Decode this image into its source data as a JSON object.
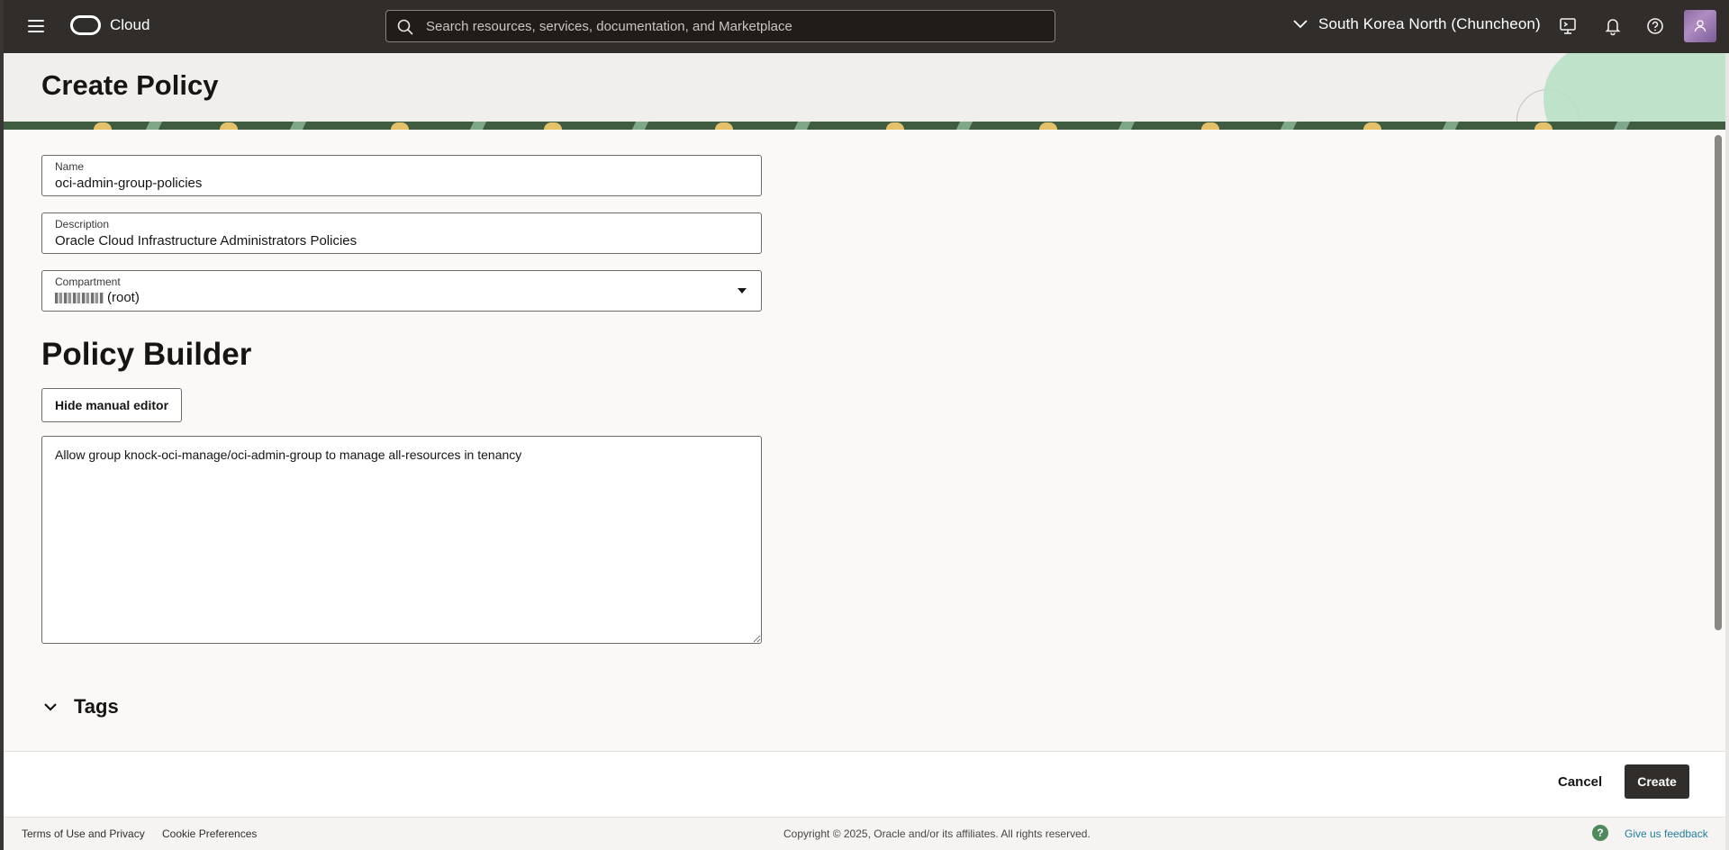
{
  "header": {
    "brand": "Cloud",
    "search_placeholder": "Search resources, services, documentation, and Marketplace",
    "region": "South Korea North (Chuncheon)",
    "icons": [
      "menu-icon",
      "oracle-logo",
      "search-icon",
      "chevron-down-icon",
      "cloud-shell-icon",
      "bell-icon",
      "help-icon",
      "user-icon"
    ]
  },
  "page": {
    "title": "Create Policy"
  },
  "form": {
    "name_label": "Name",
    "name_value": "oci-admin-group-policies",
    "description_label": "Description",
    "description_value": "Oracle Cloud Infrastructure Administrators Policies",
    "compartment_label": "Compartment",
    "compartment_suffix": "(root)"
  },
  "policy_builder": {
    "title": "Policy Builder",
    "toggle_label": "Hide manual editor",
    "statement": "Allow group knock-oci-manage/oci-admin-group to manage all-resources in tenancy"
  },
  "tags": {
    "label": "Tags"
  },
  "actions": {
    "cancel_label": "Cancel",
    "create_label": "Create"
  },
  "footer": {
    "terms": "Terms of Use and Privacy",
    "cookies": "Cookie Preferences",
    "copyright": "Copyright © 2025, Oracle and/or its affiliates. All rights reserved.",
    "help_glyph": "?",
    "feedback": "Give us feedback"
  },
  "colors": {
    "header_bg": "#312d2a",
    "primary_button": "#312d2a",
    "link": "#227e9e",
    "help_green": "#508a5c"
  }
}
